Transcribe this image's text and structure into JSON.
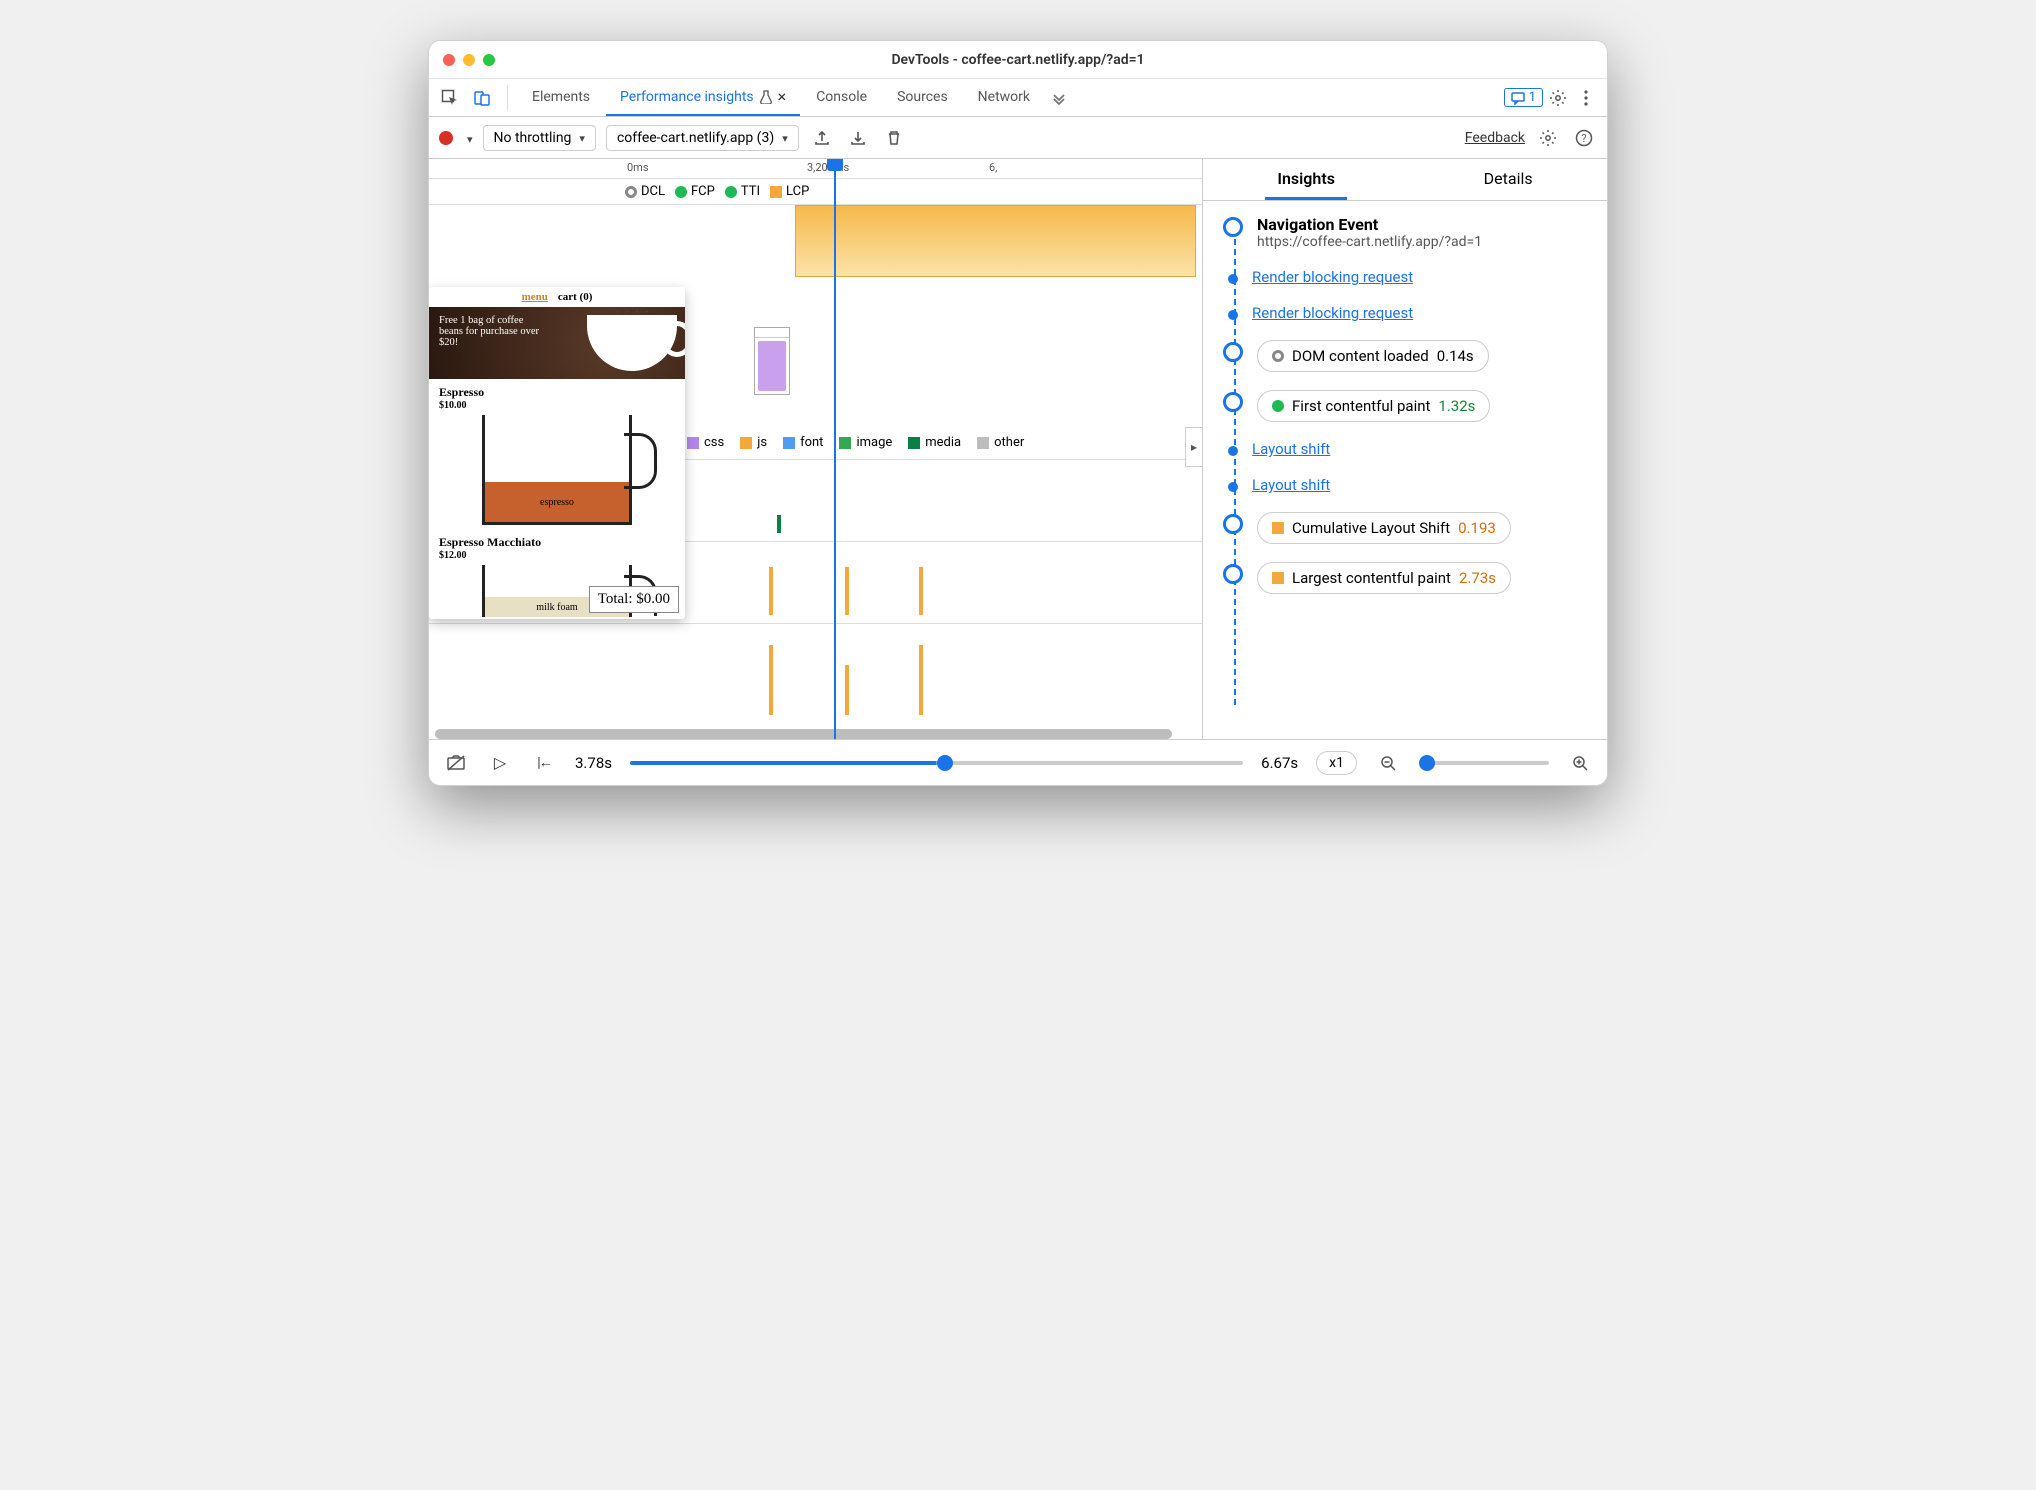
{
  "window": {
    "title": "DevTools - coffee-cart.netlify.app/?ad=1"
  },
  "tabs": {
    "items": [
      "Elements",
      "Performance insights",
      "Console",
      "Sources",
      "Network"
    ],
    "active_index": 1,
    "badge_count": "1"
  },
  "toolbar": {
    "throttling": "No throttling",
    "profile_select": "coffee-cart.netlify.app (3)",
    "feedback": "Feedback"
  },
  "ruler": {
    "t0": "0ms",
    "t1": "3,200ms",
    "t2": "6,"
  },
  "markers": [
    {
      "label": "DCL",
      "type": "ring",
      "color": "#888"
    },
    {
      "label": "FCP",
      "type": "dot",
      "color": "#1db954"
    },
    {
      "label": "TTI",
      "type": "dot",
      "color": "#1db954"
    },
    {
      "label": "LCP",
      "type": "sq",
      "color": "#f2a83b"
    }
  ],
  "legend": [
    {
      "label": "css",
      "color": "#b388eb"
    },
    {
      "label": "js",
      "color": "#f2a83b"
    },
    {
      "label": "font",
      "color": "#4f9cf0"
    },
    {
      "label": "image",
      "color": "#34a853"
    },
    {
      "label": "media",
      "color": "#0b8043"
    },
    {
      "label": "other",
      "color": "#bdbdbd"
    }
  ],
  "preview": {
    "nav_menu": "menu",
    "nav_cart": "cart (0)",
    "banner_text": "Free 1 bag of coffee beans for purchase over $20!",
    "product1": {
      "name": "Espresso",
      "price": "$10.00",
      "fill_label": "espresso"
    },
    "product2": {
      "name": "Espresso Macchiato",
      "price": "$12.00",
      "foam_label": "milk foam"
    },
    "total": "Total: $0.00"
  },
  "details": {
    "tabs": {
      "insights": "Insights",
      "details": "Details",
      "active": "Insights"
    },
    "nav_event": {
      "title": "Navigation Event",
      "url": "https://coffee-cart.netlify.app/?ad=1"
    },
    "items": [
      {
        "kind": "link",
        "text": "Render blocking request"
      },
      {
        "kind": "link",
        "text": "Render blocking request"
      },
      {
        "kind": "pill",
        "icon": "ring",
        "icon_color": "#888",
        "text": "DOM content loaded",
        "value": "0.14s",
        "vclass": ""
      },
      {
        "kind": "pill",
        "icon": "dot",
        "icon_color": "#1db954",
        "text": "First contentful paint",
        "value": "1.32s",
        "vclass": "v-good"
      },
      {
        "kind": "link",
        "text": "Layout shift"
      },
      {
        "kind": "link",
        "text": "Layout shift"
      },
      {
        "kind": "pill",
        "icon": "sq",
        "icon_color": "#f2a83b",
        "text": "Cumulative Layout Shift",
        "value": "0.193",
        "vclass": "v-warn"
      },
      {
        "kind": "pill",
        "icon": "sq",
        "icon_color": "#f2a83b",
        "text": "Largest contentful paint",
        "value": "2.73s",
        "vclass": "v-warn"
      }
    ]
  },
  "bottombar": {
    "current_time": "3.78s",
    "end_time": "6.67s",
    "speed": "x1"
  }
}
